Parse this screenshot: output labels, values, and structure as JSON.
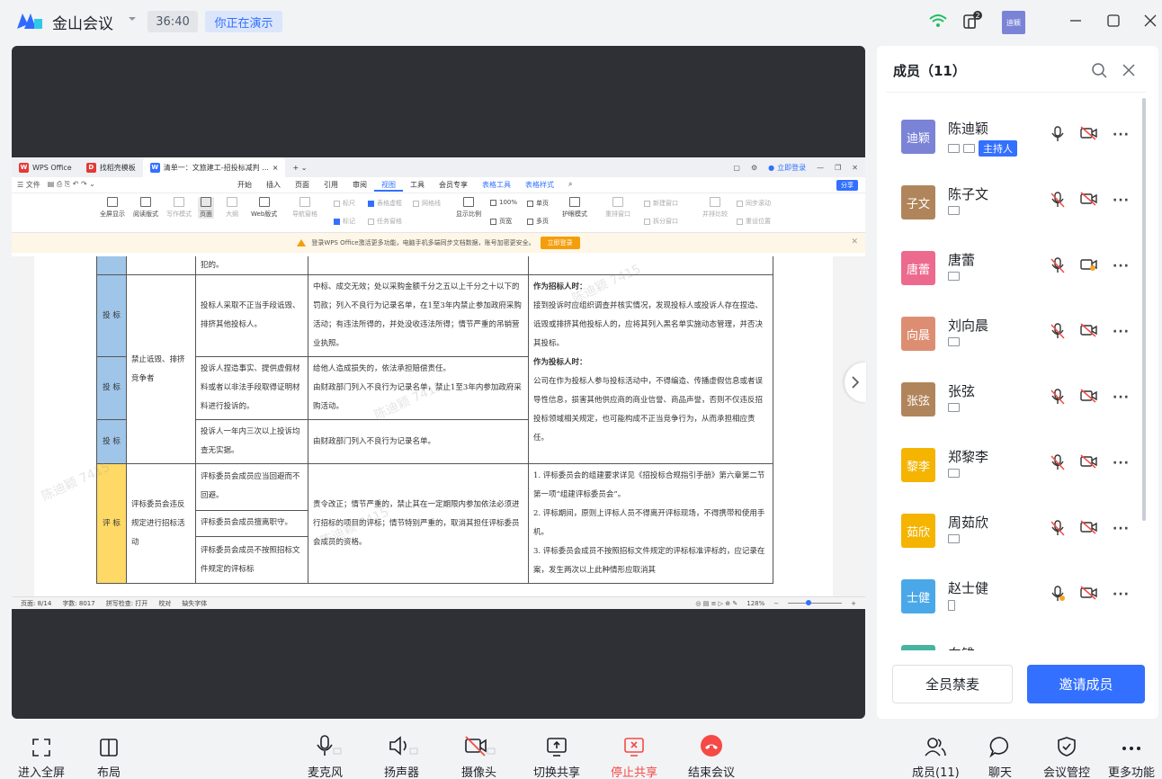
{
  "app": {
    "title": "金山会议",
    "timer": "36:40",
    "presenting_badge": "你正在演示",
    "self_avatar": "迪颖",
    "brand_color": "#3370ff"
  },
  "wps": {
    "tabs": [
      "WPS Office",
      "找稻壳模板",
      "清单一：文旅建工-招投标减判 ..."
    ],
    "login": "立即登录",
    "file_menu": "文件",
    "menu": [
      "开始",
      "插入",
      "页面",
      "引用",
      "审阅",
      "视图",
      "工具",
      "会员专享",
      "表格工具",
      "表格样式"
    ],
    "share": "分享",
    "ribbon": {
      "buttons": [
        "全屏显示",
        "阅读版式",
        "写作模式",
        "页面",
        "大纲",
        "Web版式",
        "导航窗格",
        "显示比例",
        "单页",
        "多页",
        "护眼模式",
        "重排窗口",
        "新建窗口",
        "拆分窗口",
        "并排比较",
        "同步滚动",
        "重设位置"
      ],
      "checks": [
        "标尺",
        "表格虚框",
        "网格线",
        "标记",
        "任务窗格"
      ],
      "zoom": "100%",
      "page_width": "页宽"
    },
    "notice": {
      "text": "登录WPS Office激活更多功能，电脑手机多端同步文档数据，账号加密更安全。",
      "button": "立即登录"
    },
    "doc": {
      "top_fragment": "犯的。",
      "rows": [
        {
          "cat": "投 标",
          "c3": "投标人采取不正当手段诋毁、排挤其他投标人。",
          "c4": "中标、成交无效；处以采购金额千分之五以上千分之十以下的罚款；列入不良行为记录名单，在1至3年内禁止参加政府采购活动；有违法所得的，并处没收违法所得；情节严重的吊销营业执照。"
        },
        {
          "cat": "投 标",
          "c2": "禁止诋毁、排挤竞争者",
          "c3": "投诉人捏造事实、提供虚假材料或者以非法手段取得证明材料进行投诉的。",
          "c4a": "给他人造成损失的，依法承担赔偿责任。",
          "c4b": "由财政部门列入不良行为记录名单，禁止1至3年内参加政府采购活动。"
        },
        {
          "cat": "投 标",
          "c3": "投诉人一年内三次以上投诉均查无实据。",
          "c4": "由财政部门列入不良行为记录名单。"
        }
      ],
      "c5_heading1": "作为招标人时：",
      "c5_text1": "接到投诉时应组织调查并核实情况，发现投标人或投诉人存在捏造、诋毁或排挤其他投标人的，应将其列入黑名单实施动态管理，并否决其投标。",
      "c5_heading2": "作为投标人时：",
      "c5_text2": "公司在作为投标人参与投标活动中，不得编造、传播虚假信息或者误导性信息，损害其他供应商的商业信誉、商品声誉，否则不仅违反招投标领域相关规定，也可能构成不正当竞争行为，从而承担相应责任。",
      "review": {
        "cat": "评 标",
        "c2": "评标委员会违反规定进行招标活动",
        "c3a": "评标委员会成员应当回避而不回避。",
        "c3b": "评标委员会成员擅离职守。",
        "c3c": "评标委员会成员不按照招标文件规定的评标标",
        "c4": "责令改正；情节严重的，禁止其在一定期限内参加依法必须进行招标的项目的评标；情节特别严重的，取消其担任评标委员会成员的资格。",
        "c5_1": "1.  评标委员会的组建要求详见《招投标合规指引手册》第六章第二节第一项“组建评标委员会”。",
        "c5_2": "2.  评标期间，原则上评标人员不得离开评标现场，不得携带和使用手机。",
        "c5_3": "3.  评标委员会成员不按照招标文件规定的评标标准评标的，应记录在案，发生两次以上此种情形应取消其"
      }
    },
    "status": {
      "page": "页面: 8/14",
      "words": "字数: 8017",
      "spell": "拼写检查: 打开",
      "proof": "校对",
      "font_missing": "缺失字体",
      "zoom": "128%"
    },
    "watermark": "陈迪颖 7415"
  },
  "panel": {
    "title": "成员（11）",
    "members": [
      {
        "avatar": "迪颖",
        "name": "陈迪颖",
        "color": "#7b83d6",
        "badge": "主持人",
        "device": "screens",
        "mic": "on",
        "cam": "off"
      },
      {
        "avatar": "子文",
        "name": "陈子文",
        "color": "#b1855b",
        "device": "screen",
        "mic": "muted",
        "cam": "off"
      },
      {
        "avatar": "唐蕾",
        "name": "唐蕾",
        "color": "#ec6a8e",
        "device": "screen",
        "mic": "muted",
        "cam": "warn"
      },
      {
        "avatar": "向晨",
        "name": "刘向晨",
        "color": "#dd8e72",
        "device": "screen",
        "mic": "muted",
        "cam": "off"
      },
      {
        "avatar": "张弦",
        "name": "张弦",
        "color": "#b1855b",
        "device": "screen",
        "mic": "muted",
        "cam": "off"
      },
      {
        "avatar": "黎李",
        "name": "郑黎李",
        "color": "#f4b400",
        "device": "screen",
        "mic": "muted",
        "cam": "off"
      },
      {
        "avatar": "茹欣",
        "name": "周茹欣",
        "color": "#f4b400",
        "device": "screen",
        "mic": "muted",
        "cam": "off"
      },
      {
        "avatar": "士健",
        "name": "赵士健",
        "color": "#4aa8e8",
        "device": "phone",
        "mic": "warn",
        "cam": "off"
      },
      {
        "avatar": "",
        "name": "向锥",
        "color": "#46b4a0",
        "device": "",
        "mic": "",
        "cam": ""
      }
    ],
    "mute_all": "全员禁麦",
    "invite": "邀请成员"
  },
  "toolbar": {
    "fullscreen": "进入全屏",
    "layout": "布局",
    "mic": "麦克风",
    "speaker": "扬声器",
    "camera": "摄像头",
    "switch_share": "切换共享",
    "stop_share": "停止共享",
    "end_meeting": "结束会议",
    "members": "成员(11)",
    "chat": "聊天",
    "control": "会议管控",
    "more": "更多功能"
  }
}
